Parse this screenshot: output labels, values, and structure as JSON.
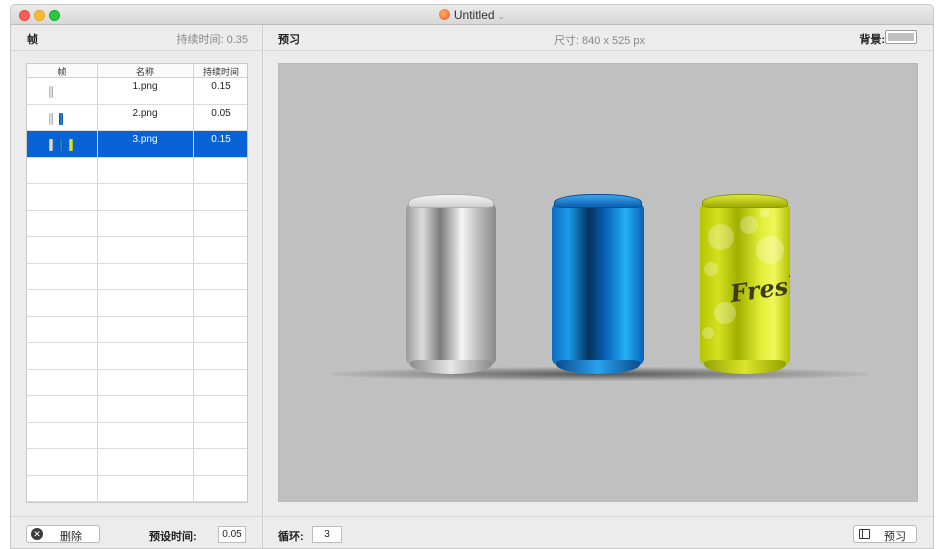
{
  "window": {
    "title": "Untitled"
  },
  "frames_panel": {
    "title": "帧",
    "total_duration": "持续时间: 0.35",
    "columns": [
      "帧",
      "名称",
      "持续时间"
    ],
    "rows": [
      {
        "name": "1.png",
        "duration": "0.15",
        "selected": false
      },
      {
        "name": "2.png",
        "duration": "0.05",
        "selected": false
      },
      {
        "name": "3.png",
        "duration": "0.15",
        "selected": true
      }
    ],
    "delete_label": "删除",
    "preset_label": "预设时间:",
    "preset_value": "0.05"
  },
  "preview_panel": {
    "title": "预习",
    "size": "尺寸: 840 x 525 px",
    "background_label": "背景:",
    "background_color": "#c0c0c0",
    "loop_label": "循环:",
    "loop_value": "3",
    "preview_button_label": "预习",
    "can_text": "Fresh"
  },
  "colors": {
    "selection": "#0a63d6",
    "can_silver": "#d0d0d0",
    "can_blue": "#1a9be8",
    "can_yellow": "#d5e120"
  },
  "icons": [
    "document-icon",
    "delete-icon",
    "preview-mode-icon",
    "chevron-down-icon"
  ]
}
